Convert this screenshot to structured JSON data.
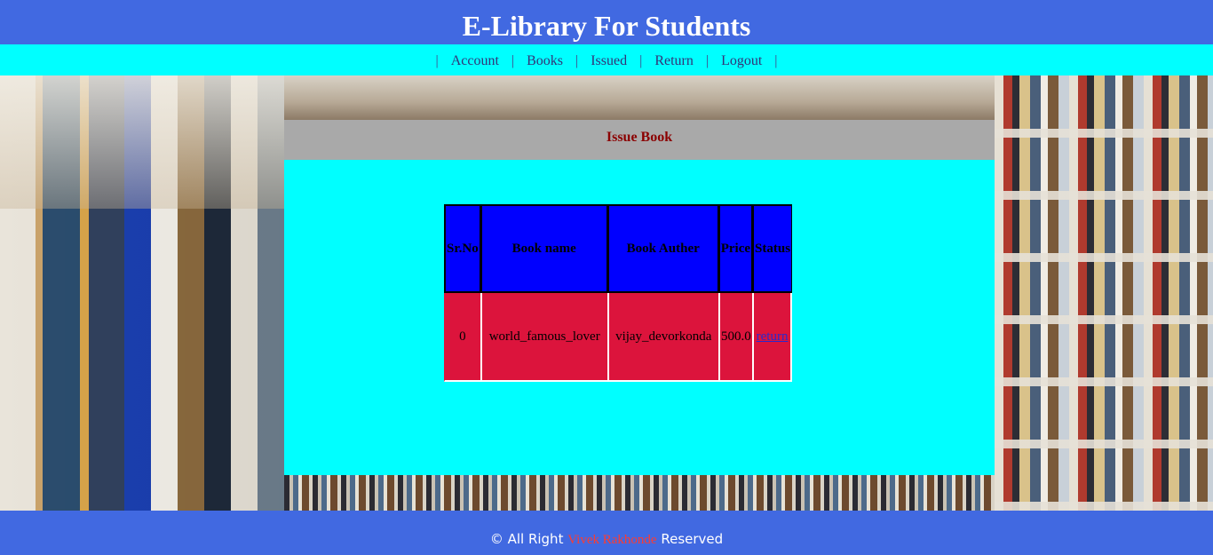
{
  "header": {
    "title": "E-Library For Students"
  },
  "nav": {
    "items": [
      {
        "label": "Account"
      },
      {
        "label": "Books"
      },
      {
        "label": "Issued"
      },
      {
        "label": "Return"
      },
      {
        "label": "Logout"
      }
    ],
    "separator": "|"
  },
  "panel": {
    "title": "Issue Book",
    "table": {
      "headers": [
        "Sr.No",
        "Book name",
        "Book Auther",
        "Price",
        "Status"
      ],
      "rows": [
        {
          "sr": "0",
          "name": "world_famous_lover",
          "author": "vijay_devorkonda",
          "price": "500.0",
          "status": "return"
        }
      ]
    }
  },
  "footer": {
    "prefix": "© All Right",
    "author": "Vivek Rakhonde",
    "suffix": "Reserved"
  },
  "colors": {
    "header_bg": "#4169e1",
    "nav_bg": "#00ffff",
    "panel_head_bg": "#a9a9a9",
    "table_head_bg": "#0000ff",
    "table_row_bg": "#dc143c",
    "author_color": "#ff3b30"
  }
}
